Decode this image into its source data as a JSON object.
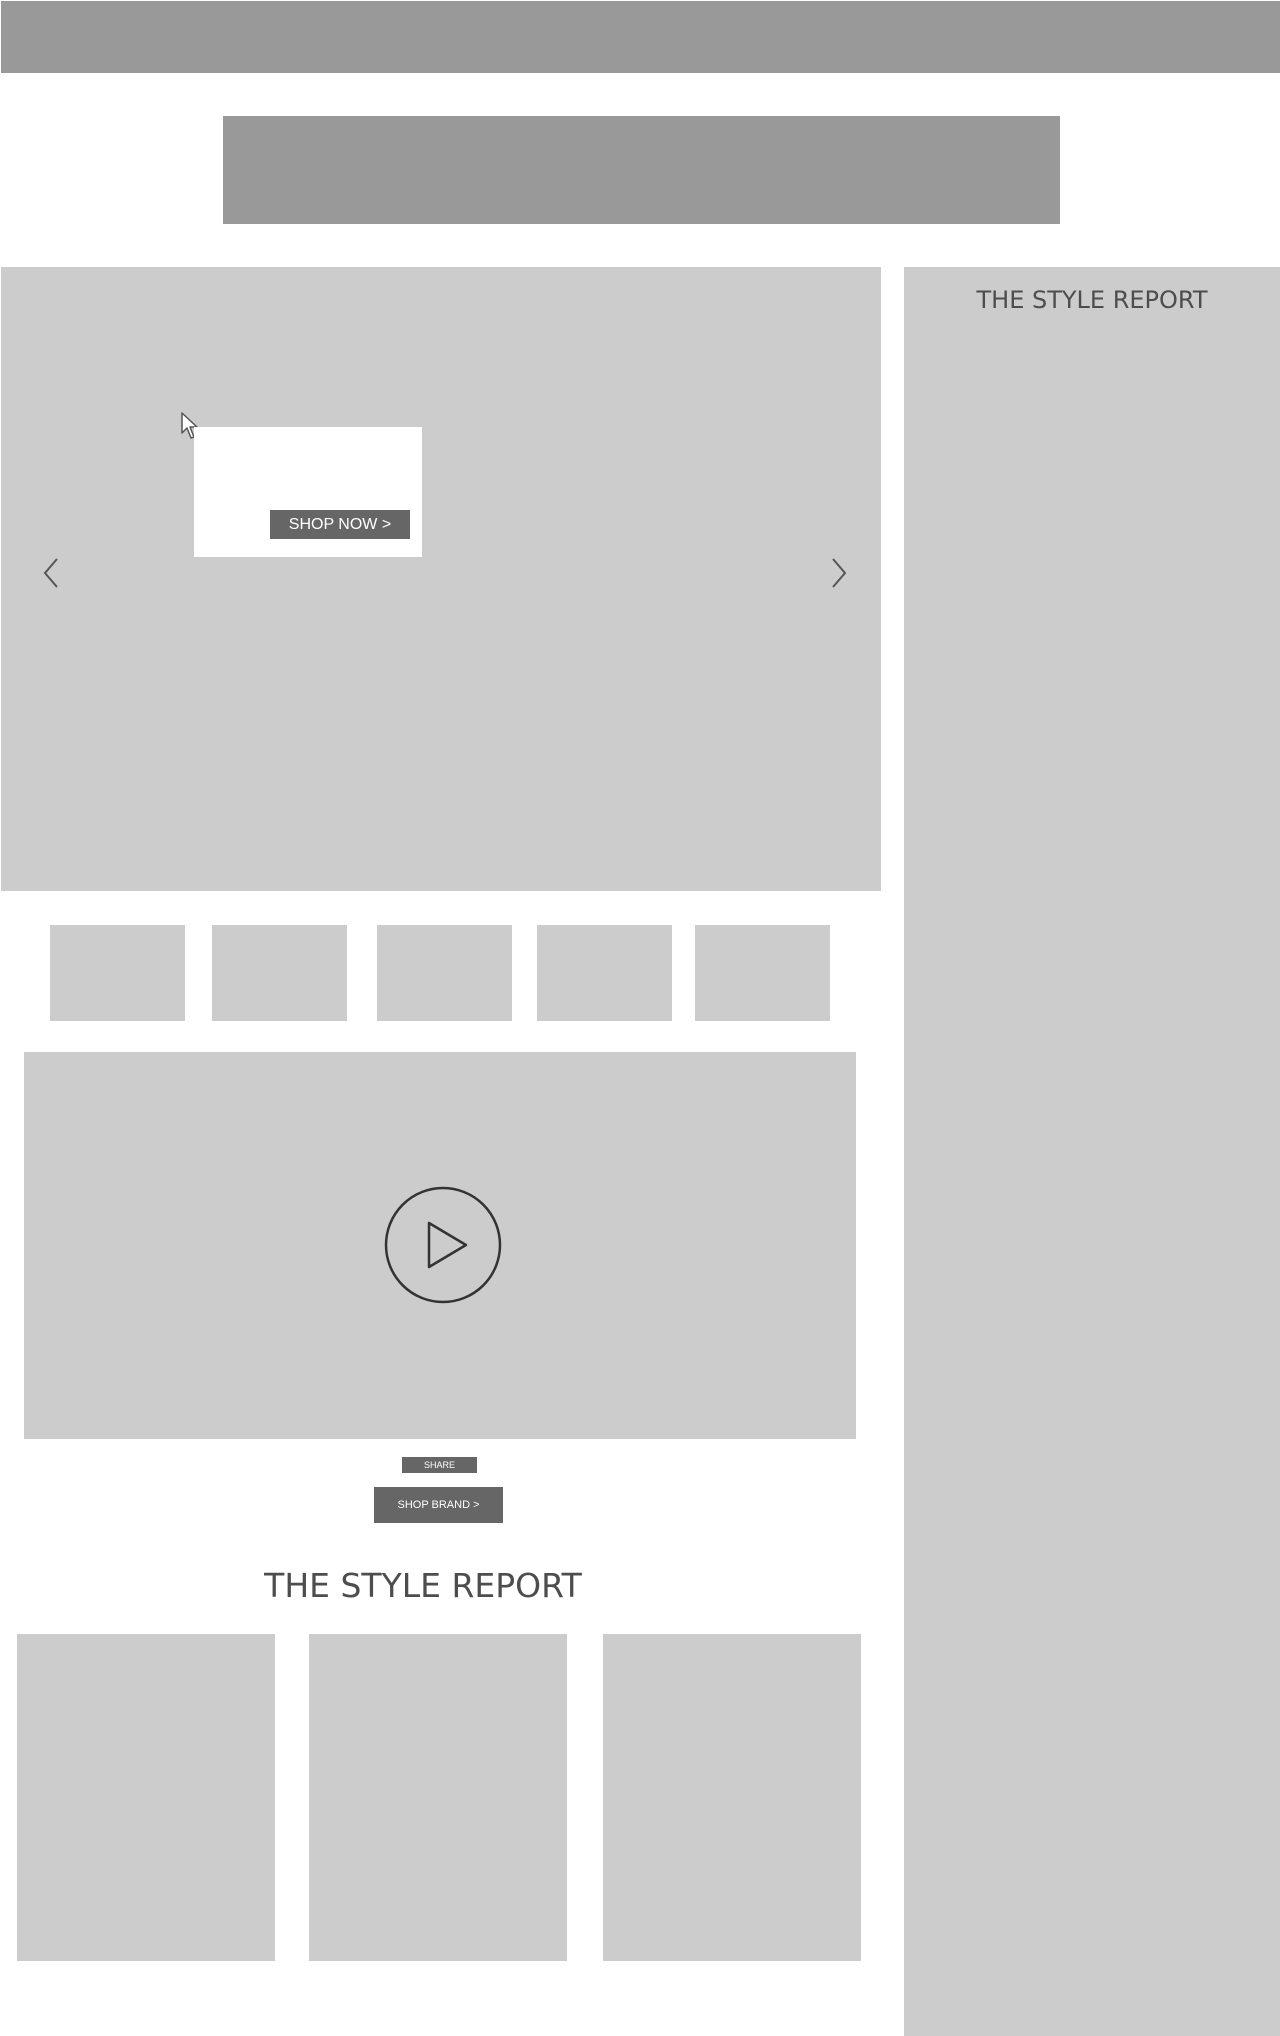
{
  "hero": {
    "promo_button_label": "SHOP NOW >"
  },
  "video": {
    "share_label": "SHARE",
    "shop_brand_label": "SHOP BRAND >"
  },
  "style_report": {
    "heading": "THE STYLE REPORT"
  },
  "sidebar": {
    "title": "THE STYLE REPORT"
  },
  "colors": {
    "placeholder_dark": "#999999",
    "placeholder_light": "#cccccc",
    "button": "#666666",
    "heading_text": "#4d4d4d"
  }
}
